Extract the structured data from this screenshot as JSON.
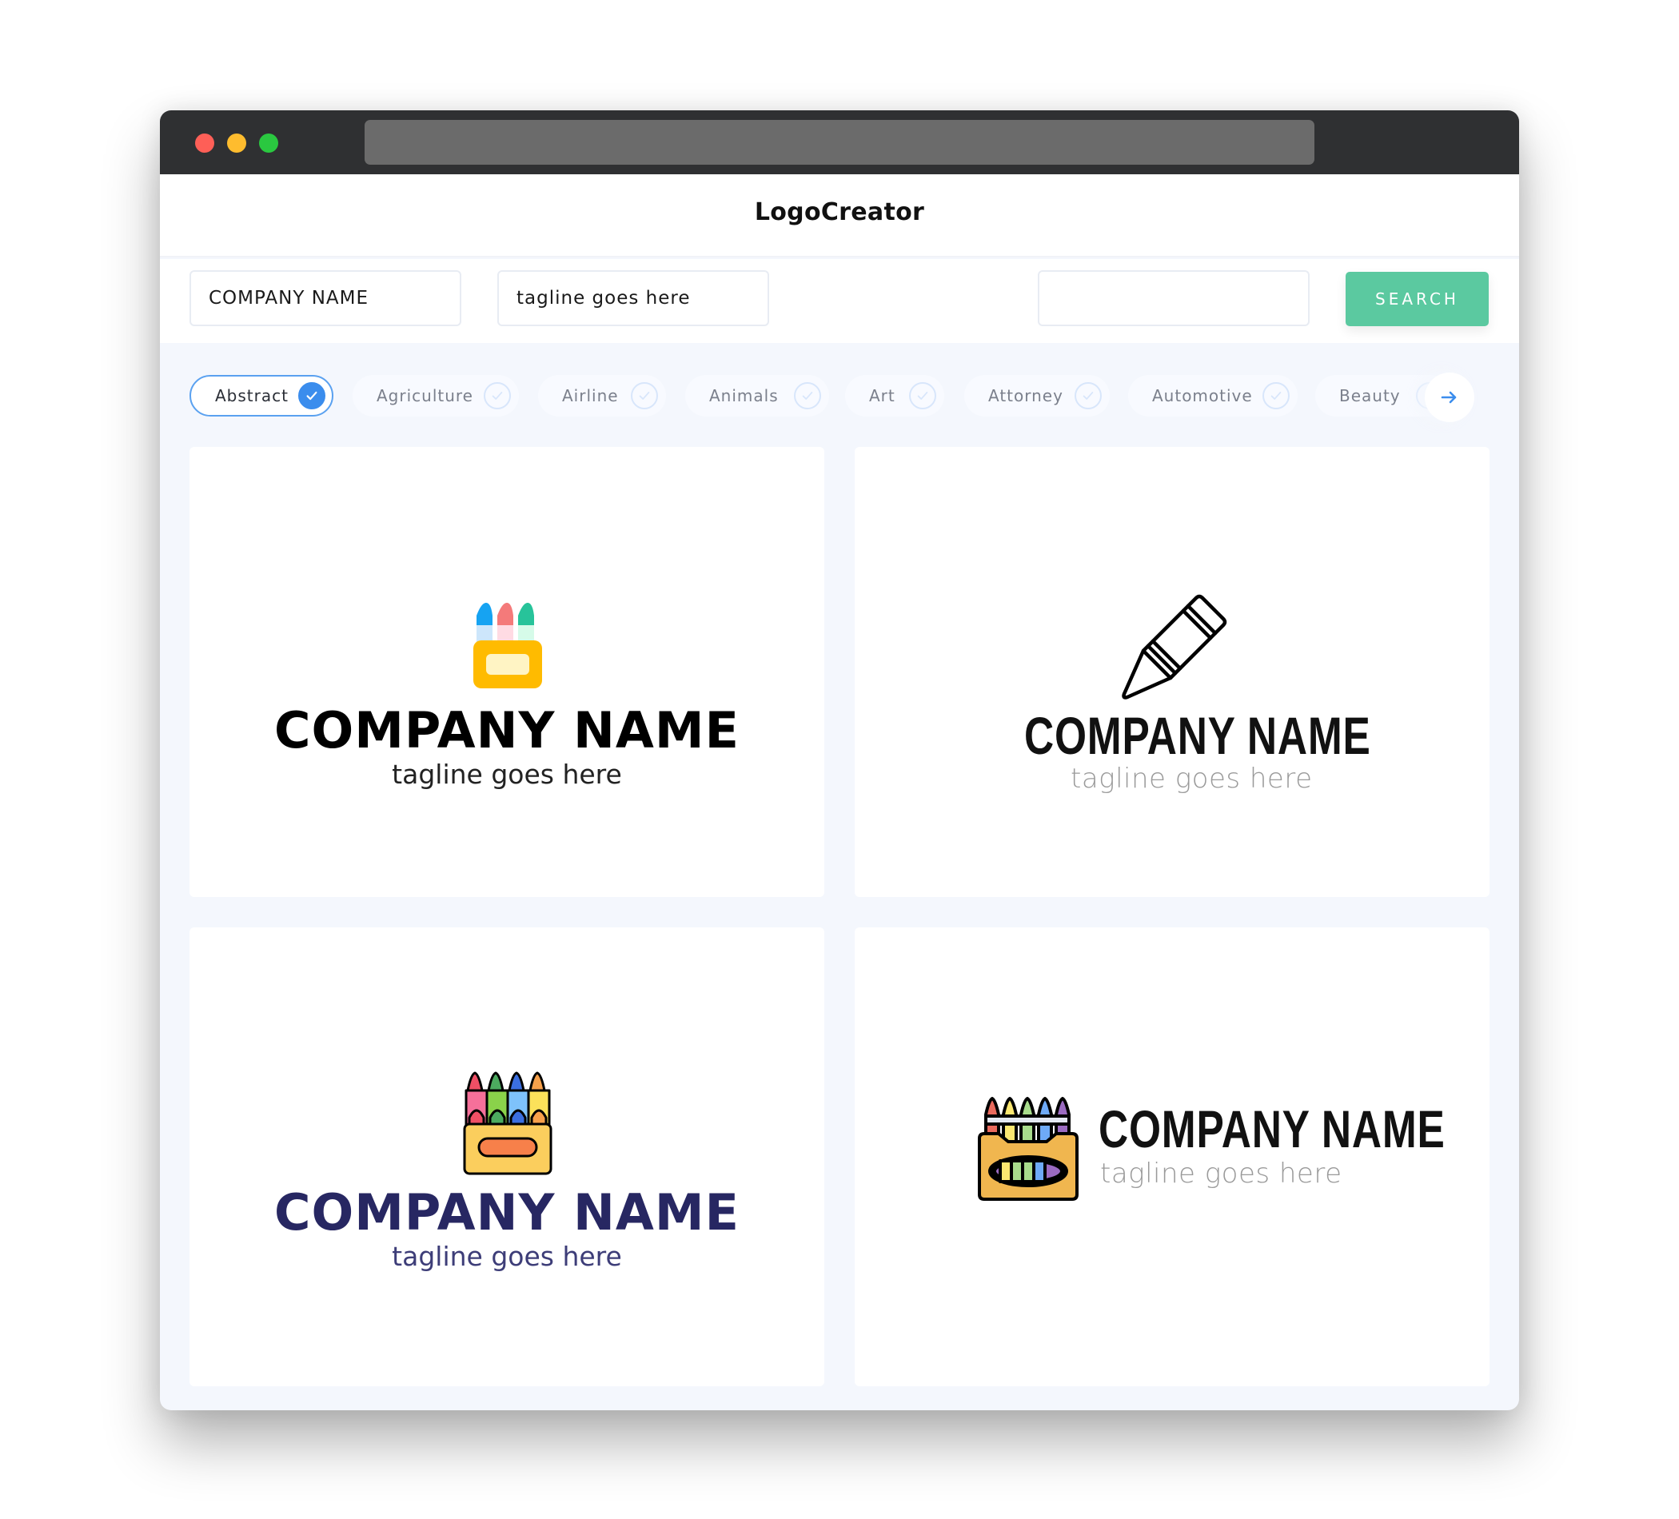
{
  "window": {
    "traffic_lights": [
      "close",
      "minimize",
      "maximize"
    ],
    "url": ""
  },
  "header": {
    "brand": "LogoCreator"
  },
  "search": {
    "company_value": "COMPANY NAME",
    "tagline_value": "tagline goes here",
    "extra_value": "",
    "button_label": "SEARCH",
    "accent": "#5bc9a0"
  },
  "categories": {
    "items": [
      {
        "label": "Abstract",
        "selected": true
      },
      {
        "label": "Agriculture",
        "selected": false
      },
      {
        "label": "Airline",
        "selected": false
      },
      {
        "label": "Animals",
        "selected": false
      },
      {
        "label": "Art",
        "selected": false
      },
      {
        "label": "Attorney",
        "selected": false
      },
      {
        "label": "Automotive",
        "selected": false
      },
      {
        "label": "Beauty",
        "selected": false
      }
    ],
    "next_icon": "arrow-right-icon",
    "accent": "#3b8ded"
  },
  "logos": [
    {
      "icon": "crayon-box-yellow-icon",
      "company": "COMPANY NAME",
      "tagline": "tagline goes here",
      "name_color": "#000000",
      "tagline_color": "#222222"
    },
    {
      "icon": "crayon-outline-icon",
      "company": "COMPANY NAME",
      "tagline": "tagline goes here",
      "name_color": "#111111",
      "tagline_color": "#9a9a9a"
    },
    {
      "icon": "crayon-box-four-colors-icon",
      "company": "COMPANY NAME",
      "tagline": "tagline goes here",
      "name_color": "#272762",
      "tagline_color": "#3d3d78"
    },
    {
      "icon": "crayon-box-five-colors-icon",
      "company": "COMPANY NAME",
      "tagline": "tagline goes here",
      "name_color": "#111111",
      "tagline_color": "#9a9a9a"
    }
  ]
}
